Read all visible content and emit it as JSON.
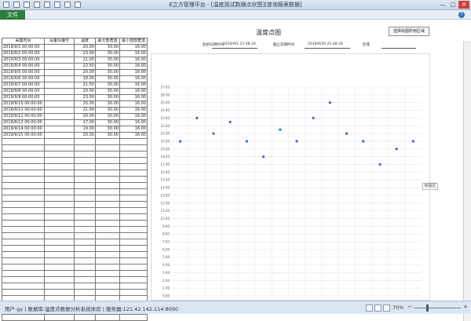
{
  "window": {
    "title": "E立方管理平台 - [温度测试数据点状图][查询报表数据]",
    "minimize": "—",
    "maximize": "□",
    "close": "✕",
    "qat_icons": [
      "app-icon",
      "save-icon",
      "undo-icon",
      "redo-icon",
      "print-icon",
      "export-icon",
      "chart-icon",
      "dropdown-icon"
    ]
  },
  "ribbon": {
    "file_tab": "文件",
    "help": "?"
  },
  "table": {
    "headers": [
      "采集时间",
      "设备仪编号",
      "温度",
      "最大部宽值",
      "最小值部宽值"
    ],
    "rows": [
      [
        "2019/9/1 00:00:00",
        "",
        "20.00",
        "30.00",
        "16.00"
      ],
      [
        "2019/9/2 00:00:00",
        "",
        "23.00",
        "30.00",
        "16.00"
      ],
      [
        "2019/9/3 00:00:00",
        "",
        "21.00",
        "30.00",
        "16.00"
      ],
      [
        "2019/9/4 00:00:00",
        "",
        "22.50",
        "30.00",
        "16.00"
      ],
      [
        "2019/9/5 00:00:00",
        "",
        "20.00",
        "30.00",
        "16.00"
      ],
      [
        "2019/9/6 00:00:00",
        "",
        "18.00",
        "30.00",
        "16.00"
      ],
      [
        "2019/9/7 00:00:00",
        "",
        "21.50",
        "30.00",
        "16.00"
      ],
      [
        "2019/9/8 00:00:00",
        "",
        "20.00",
        "30.00",
        "16.00"
      ],
      [
        "2019/9/9 00:00:00",
        "",
        "23.00",
        "30.00",
        "16.00"
      ],
      [
        "2019/9/10 00:00:00",
        "",
        "25.00",
        "30.00",
        "16.00"
      ],
      [
        "2019/9/11 00:00:00",
        "",
        "21.00",
        "30.00",
        "16.00"
      ],
      [
        "2019/9/12 00:00:00",
        "",
        "20.00",
        "30.00",
        "16.00"
      ],
      [
        "2019/9/13 00:00:00",
        "",
        "17.00",
        "30.00",
        "16.00"
      ],
      [
        "2019/9/14 00:00:00",
        "",
        "19.00",
        "30.00",
        "16.00"
      ],
      [
        "2019/9/15 00:00:00",
        "",
        "20.00",
        "30.00",
        "16.00"
      ]
    ],
    "empty_rows": 29
  },
  "report": {
    "title": "温度点图",
    "start_label": "起始日期时间",
    "start_value": "2019/9/1 21:48:16",
    "end_label": "截止日期时间",
    "end_value": "2019/9/30 21:48:16",
    "device_label": "区域",
    "device_value": "",
    "select_button": "选择标图所用区域",
    "plot_area_label": "绘图区"
  },
  "chart_data": {
    "type": "scatter",
    "y_ticks": [
      "27.00",
      "26.00",
      "25.00",
      "24.00",
      "23.00",
      "22.00",
      "21.00",
      "20.00",
      "19.00",
      "18.00",
      "17.00",
      "16.00",
      "15.00",
      "14.00",
      "13.00",
      "12.00",
      "11.00",
      "10.00",
      "9.00",
      "8.00",
      "7.00",
      "6.00",
      "5.00",
      "4.00",
      "3.00",
      "2.00",
      "1.00",
      "0.00"
    ],
    "ylim": [
      0,
      27
    ],
    "grid": true,
    "series": [
      {
        "values": [
          20.0,
          23.0,
          21.0,
          22.5,
          20.0,
          18.0,
          21.5,
          20.0,
          23.0,
          25.0,
          21.0,
          20.0,
          17.0,
          19.0,
          20.0
        ]
      }
    ],
    "marker_color": "#2f6fc7"
  },
  "status": {
    "text": "用户:gy | 数据库:温度点数据分析系统体验 | 服务器:121.42.142.114:8090",
    "zoom": "70%",
    "zoom_minus": "−",
    "zoom_plus": "+"
  }
}
